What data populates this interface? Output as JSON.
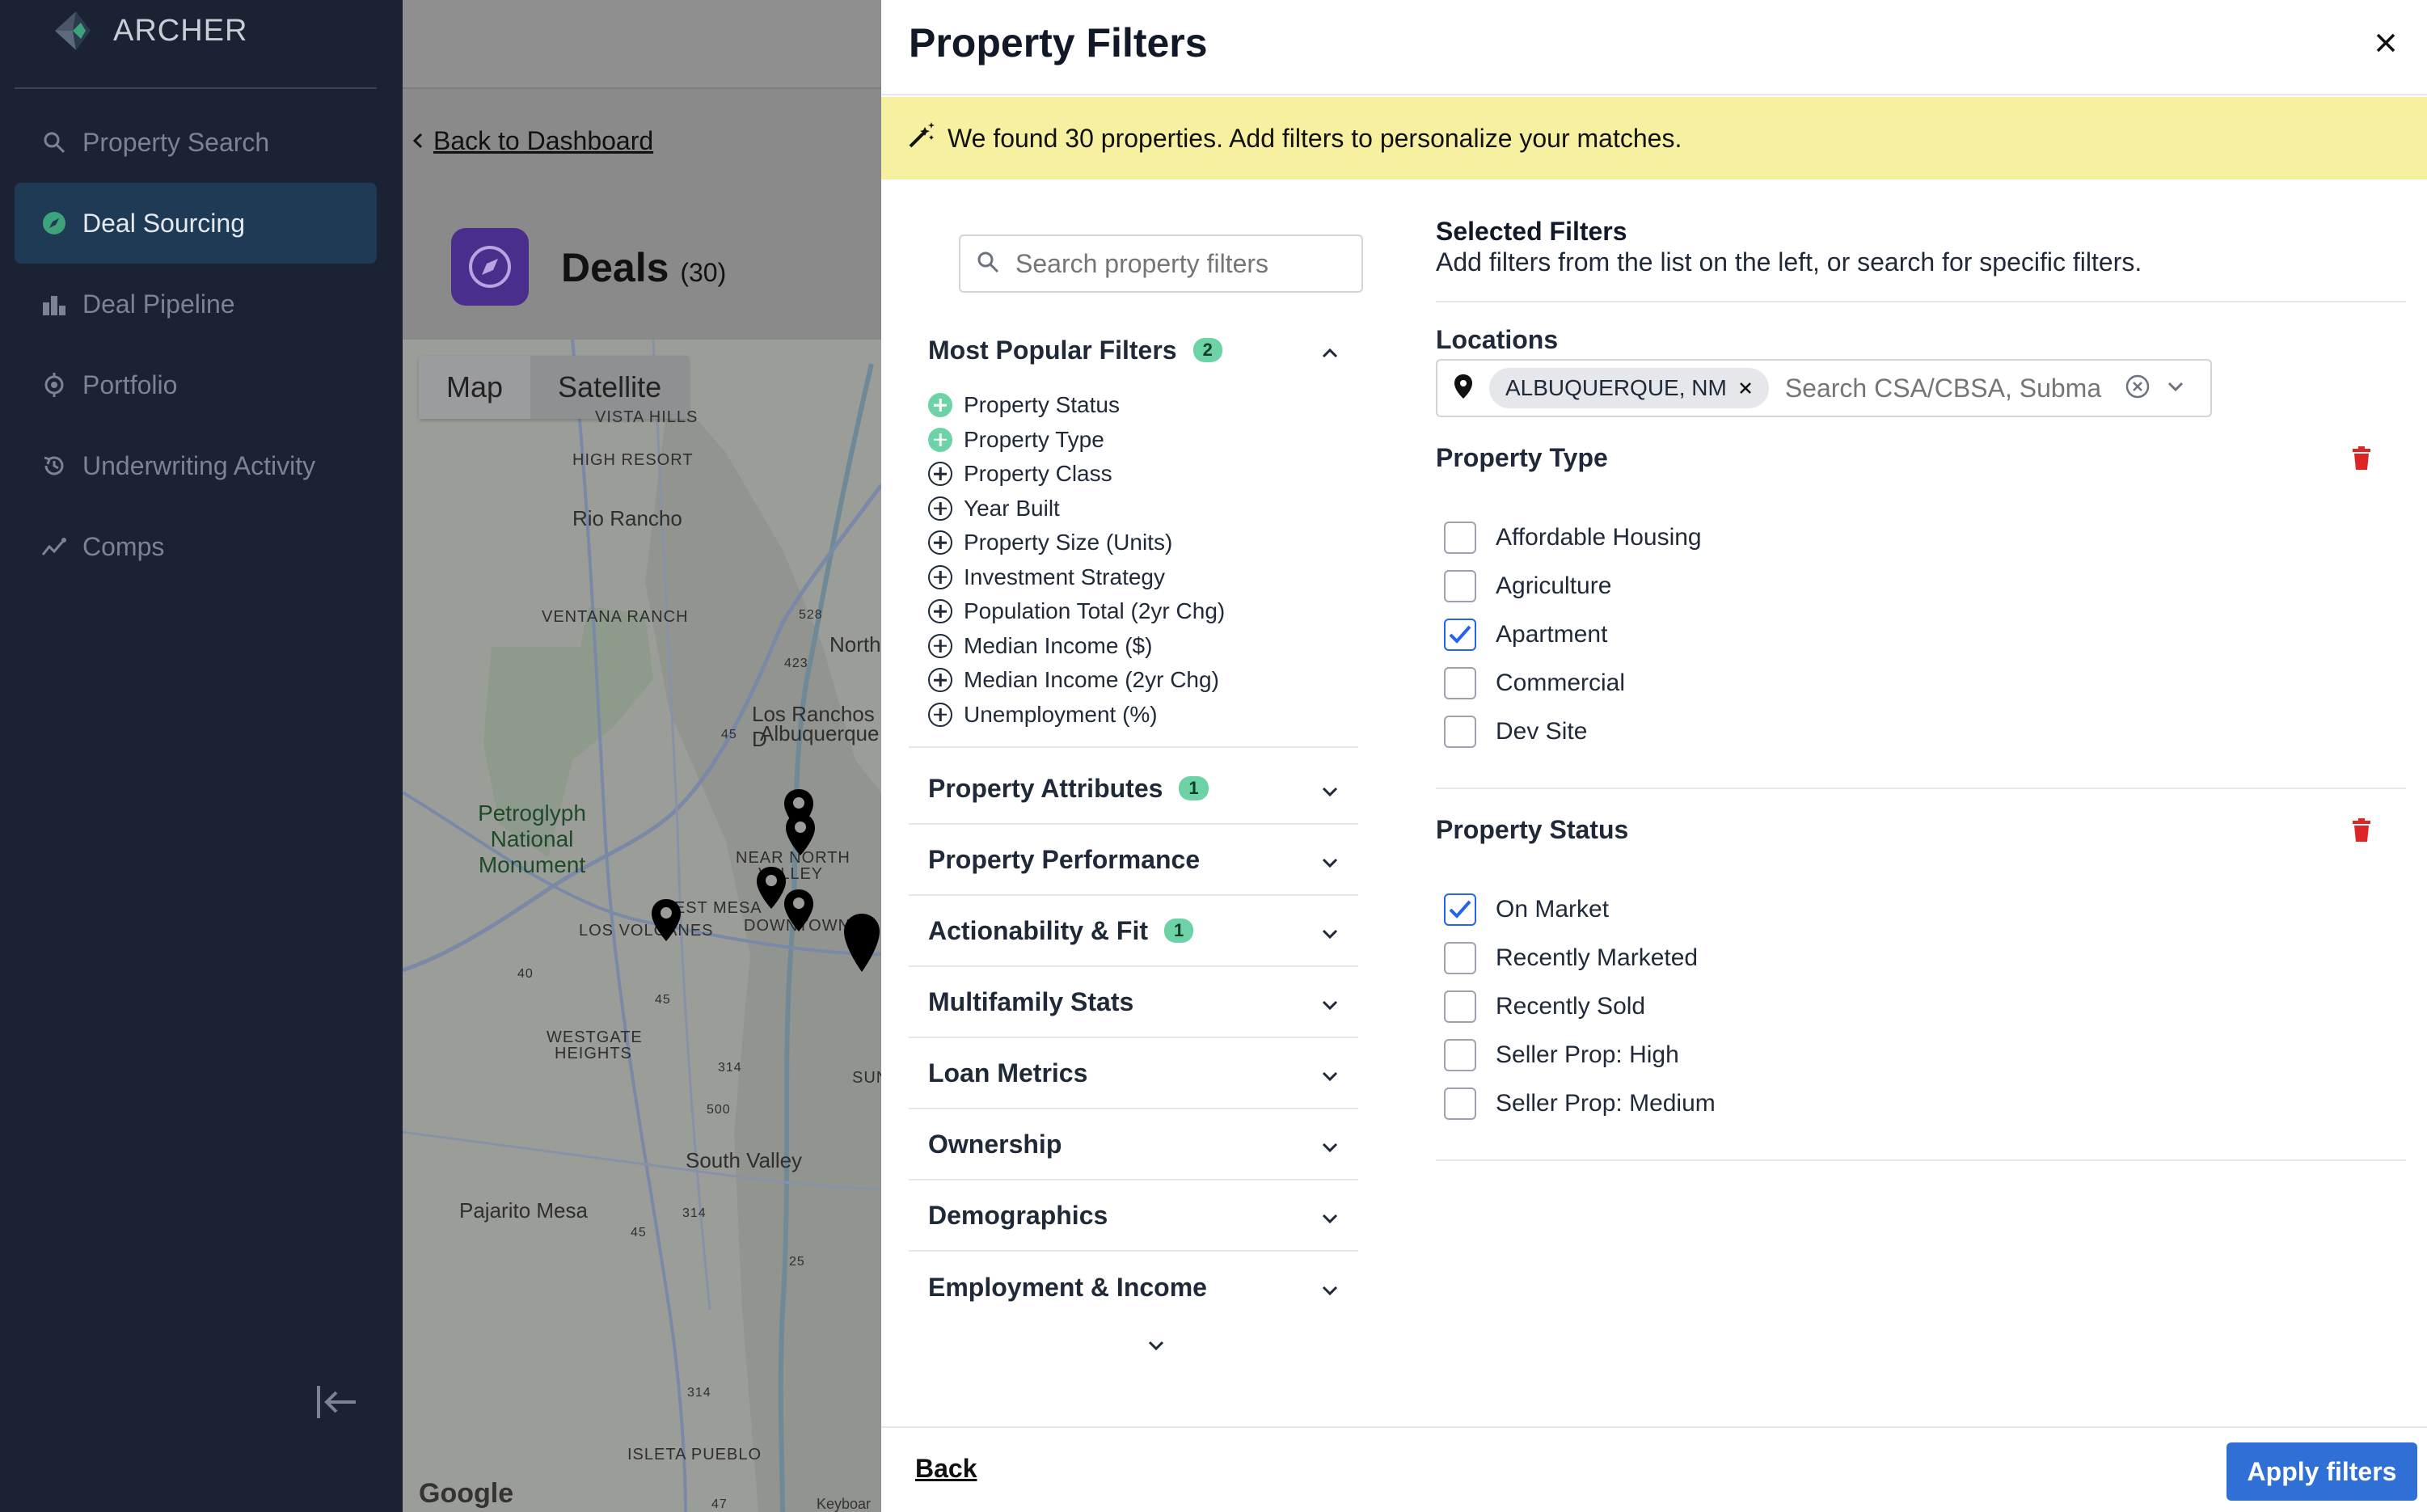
{
  "sidebar": {
    "logo_text": "ARCHER",
    "items": [
      {
        "label": "Property Search",
        "icon": "search-icon"
      },
      {
        "label": "Deal Sourcing",
        "icon": "compass-icon",
        "active": true
      },
      {
        "label": "Deal Pipeline",
        "icon": "pipeline-icon"
      },
      {
        "label": "Portfolio",
        "icon": "portfolio-icon"
      },
      {
        "label": "Underwriting Activity",
        "icon": "history-icon"
      },
      {
        "label": "Comps",
        "icon": "comps-icon"
      }
    ]
  },
  "dashboard": {
    "back_link": "Back to Dashboard",
    "deals_title": "Deals",
    "deals_count": "(30)",
    "map_tabs": [
      "Map",
      "Satellite"
    ],
    "map_labels": {
      "vista_hills": "VISTA HILLS",
      "high_resort": "HIGH RESORT",
      "rio_rancho": "Rio Rancho",
      "ventana_ranch": "VENTANA RANCH",
      "north": "North",
      "los_ranchos": "Los Ranchos D",
      "albuquerque": "Albuquerque",
      "petroglyph": "Petroglyph National Monument",
      "near_north": "NEAR NORTH",
      "valley": "VALLEY",
      "west_mesa": "WEST MESA",
      "los_volcanes": "LOS VOLCANES",
      "downtown": "DOWNTOWN",
      "westgate": "WESTGATE",
      "heights": "HEIGHTS",
      "sun": "SUN",
      "south_valley": "South Valley",
      "pajarito": "Pajarito Mesa",
      "isleta": "ISLETA PUEBLO",
      "r528": "528",
      "r423": "423",
      "r45a": "45",
      "r40": "40",
      "r45b": "45",
      "r314a": "314",
      "r500": "500",
      "r314b": "314",
      "r45c": "45",
      "r25": "25",
      "r314c": "314",
      "r47": "47"
    },
    "google": "Google",
    "keyboard": "Keyboar"
  },
  "modal": {
    "title": "Property Filters",
    "banner": "We found 30 properties. Add filters to personalize your matches.",
    "search_placeholder": "Search property filters",
    "popular": {
      "title": "Most Popular Filters",
      "badge": "2",
      "items": [
        {
          "label": "Property Status",
          "selected": true
        },
        {
          "label": "Property Type",
          "selected": true
        },
        {
          "label": "Property Class",
          "selected": false
        },
        {
          "label": "Year Built",
          "selected": false
        },
        {
          "label": "Property Size (Units)",
          "selected": false
        },
        {
          "label": "Investment Strategy",
          "selected": false
        },
        {
          "label": "Population Total (2yr Chg)",
          "selected": false
        },
        {
          "label": "Median Income ($)",
          "selected": false
        },
        {
          "label": "Median Income (2yr Chg)",
          "selected": false
        },
        {
          "label": "Unemployment (%)",
          "selected": false
        }
      ]
    },
    "sections": [
      {
        "label": "Property Attributes",
        "badge": "1"
      },
      {
        "label": "Property Performance",
        "badge": ""
      },
      {
        "label": "Actionability & Fit",
        "badge": "1"
      },
      {
        "label": "Multifamily Stats",
        "badge": ""
      },
      {
        "label": "Loan Metrics",
        "badge": ""
      },
      {
        "label": "Ownership",
        "badge": ""
      },
      {
        "label": "Demographics",
        "badge": ""
      },
      {
        "label": "Employment & Income",
        "badge": ""
      }
    ],
    "selected": {
      "title": "Selected Filters",
      "subtitle": "Add filters from the list on the left, or search for specific filters."
    },
    "locations": {
      "title": "Locations",
      "chip": "ALBUQUERQUE, NM",
      "placeholder": "Search CSA/CBSA, Subma"
    },
    "property_type": {
      "title": "Property Type",
      "options": [
        {
          "label": "Affordable Housing",
          "checked": false
        },
        {
          "label": "Agriculture",
          "checked": false
        },
        {
          "label": "Apartment",
          "checked": true
        },
        {
          "label": "Commercial",
          "checked": false
        },
        {
          "label": "Dev Site",
          "checked": false
        }
      ]
    },
    "property_status": {
      "title": "Property Status",
      "options": [
        {
          "label": "On Market",
          "checked": true
        },
        {
          "label": "Recently Marketed",
          "checked": false
        },
        {
          "label": "Recently Sold",
          "checked": false
        },
        {
          "label": "Seller Prop: High",
          "checked": false
        },
        {
          "label": "Seller Prop: Medium",
          "checked": false
        }
      ]
    },
    "footer": {
      "back": "Back",
      "apply": "Apply filters"
    }
  },
  "colors": {
    "sidebar_bg": "#1a2233",
    "active_nav": "#1f3a55",
    "banner_bg": "#f6f0a0",
    "badge": "#6dd3a7",
    "primary": "#2f6fd6",
    "trash": "#dc2626"
  }
}
